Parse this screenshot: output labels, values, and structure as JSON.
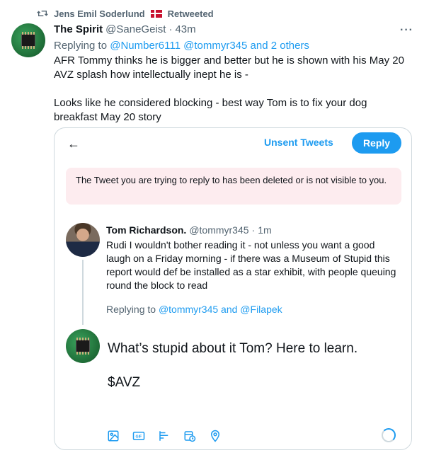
{
  "retweet": {
    "user": "Jens Emil Soderlund",
    "label": "Retweeted"
  },
  "tweet": {
    "name": "The Spirit",
    "handle": "@SaneGeist",
    "dot": "·",
    "time": "43m",
    "more": "···",
    "replying_prefix": "Replying to ",
    "replying_to": "@Number6111 @tommyr345 and 2 others",
    "paragraph1": "AFR Tommy thinks he is bigger and better but he is shown with his May 20 AVZ splash how intellectually inept he is -",
    "paragraph2": "Looks like he considered blocking - best way Tom is to fix your dog breakfast May 20 story"
  },
  "card": {
    "back": "←",
    "unsent": "Unsent Tweets",
    "reply_button": "Reply",
    "notice": "The Tweet you are trying to reply to has been deleted or is not visible to you.",
    "quoted": {
      "name": "Tom Richardson.",
      "handle": "@tommyr345",
      "dot": "·",
      "time": "1m",
      "text": "Rudi I wouldn't bother reading it - not unless you want a good laugh on a Friday morning - if there was a Museum of Stupid this report would def be installed as a star exhibit, with people queuing round the block to read",
      "replying_prefix": "Replying to ",
      "replying_to": "@tommyr345 and @Filapek"
    },
    "compose_line1": "What’s stupid about it Tom? Here to learn.",
    "compose_line2": "$AVZ",
    "toolbar": [
      "image-icon",
      "gif-icon",
      "poll-icon",
      "schedule-icon",
      "location-icon"
    ]
  },
  "colors": {
    "accent": "#1d9bf0",
    "muted": "#536471",
    "notice_bg": "#fdecef"
  }
}
